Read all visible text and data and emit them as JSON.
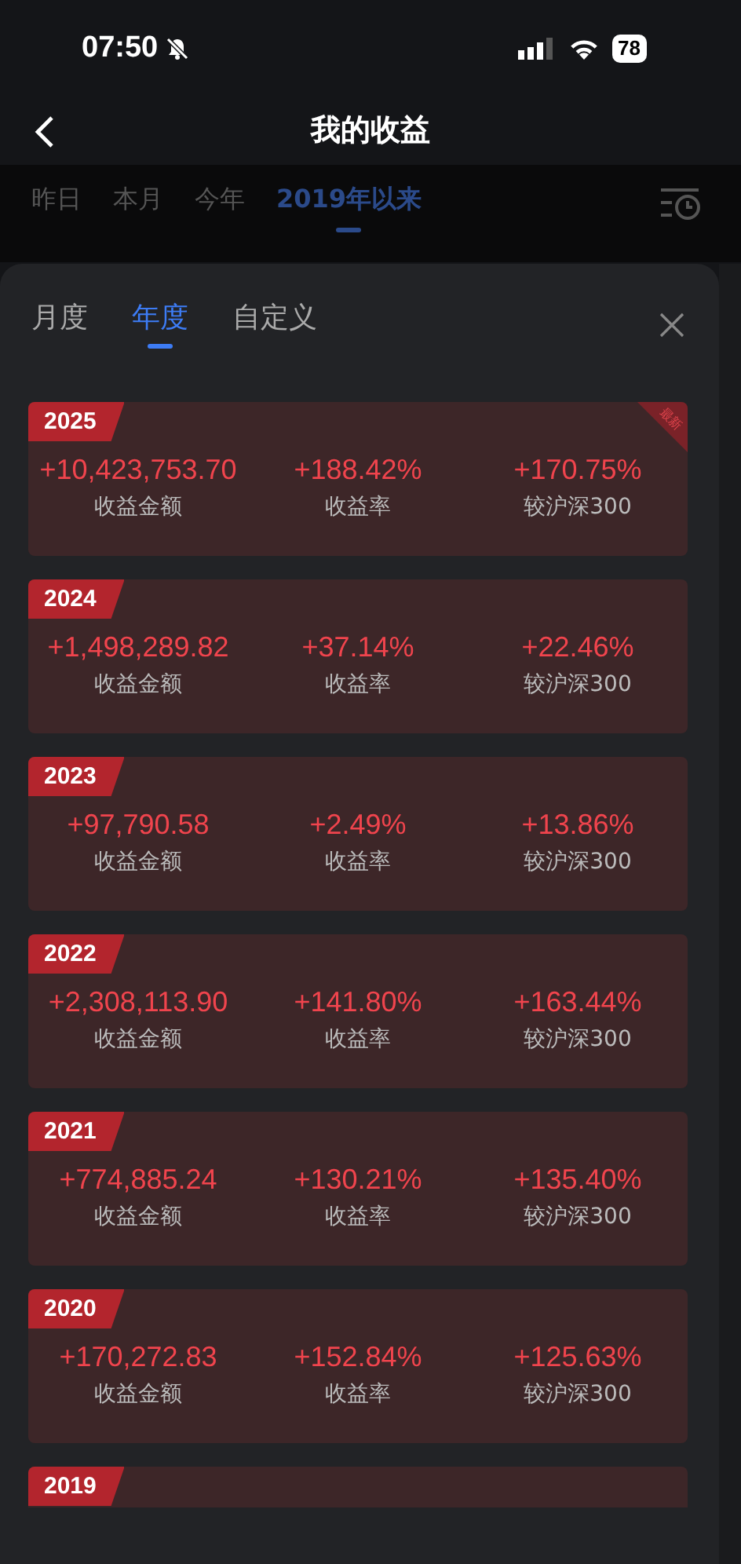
{
  "status_bar": {
    "time": "07:50",
    "battery": "78"
  },
  "header": {
    "title": "我的收益"
  },
  "period_tabs": [
    {
      "label": "昨日",
      "selected": false
    },
    {
      "label": "本月",
      "selected": false
    },
    {
      "label": "今年",
      "selected": false
    },
    {
      "label": "2019年以来",
      "selected": true
    }
  ],
  "sheet": {
    "tabs": [
      {
        "label": "月度",
        "selected": false
      },
      {
        "label": "年度",
        "selected": true
      },
      {
        "label": "自定义",
        "selected": false
      }
    ],
    "years": [
      {
        "year": "2025",
        "badge": "最新",
        "amount": "+10,423,753.70",
        "amount_label": "收益金额",
        "rate": "+188.42%",
        "rate_label": "收益率",
        "benchmark": "+170.75%",
        "benchmark_label": "较沪深300"
      },
      {
        "year": "2024",
        "amount": "+1,498,289.82",
        "amount_label": "收益金额",
        "rate": "+37.14%",
        "rate_label": "收益率",
        "benchmark": "+22.46%",
        "benchmark_label": "较沪深300"
      },
      {
        "year": "2023",
        "amount": "+97,790.58",
        "amount_label": "收益金额",
        "rate": "+2.49%",
        "rate_label": "收益率",
        "benchmark": "+13.86%",
        "benchmark_label": "较沪深300"
      },
      {
        "year": "2022",
        "amount": "+2,308,113.90",
        "amount_label": "收益金额",
        "rate": "+141.80%",
        "rate_label": "收益率",
        "benchmark": "+163.44%",
        "benchmark_label": "较沪深300"
      },
      {
        "year": "2021",
        "amount": "+774,885.24",
        "amount_label": "收益金额",
        "rate": "+130.21%",
        "rate_label": "收益率",
        "benchmark": "+135.40%",
        "benchmark_label": "较沪深300"
      },
      {
        "year": "2020",
        "amount": "+170,272.83",
        "amount_label": "收益金额",
        "rate": "+152.84%",
        "rate_label": "收益率",
        "benchmark": "+125.63%",
        "benchmark_label": "较沪深300"
      },
      {
        "year": "2019"
      }
    ]
  }
}
